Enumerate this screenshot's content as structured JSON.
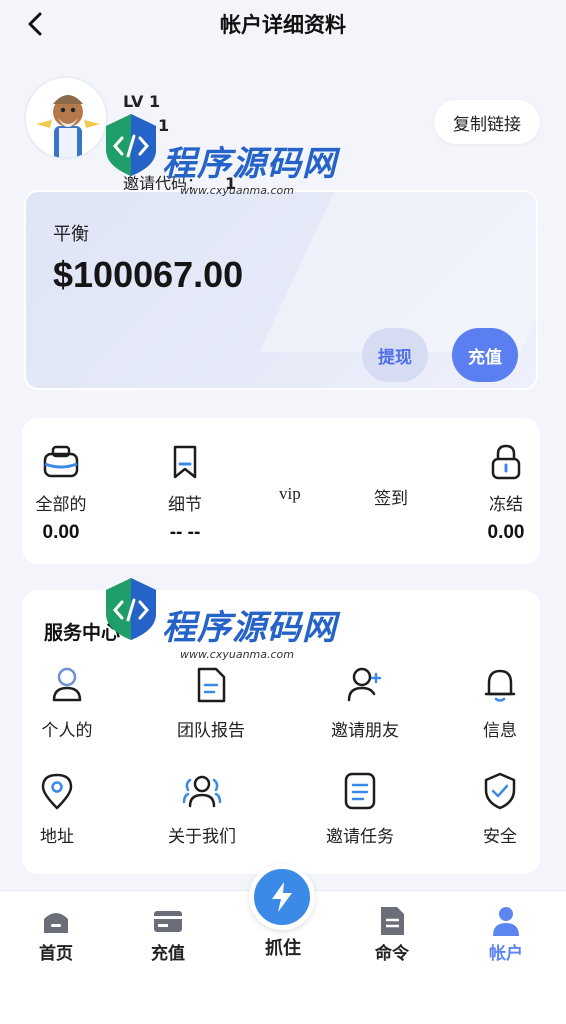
{
  "header": {
    "title": "帐户详细资料"
  },
  "profile": {
    "level": "LV 1",
    "vip": "1",
    "invite_label": "邀请代码：",
    "invite_code": "1",
    "copy_button": "复制链接"
  },
  "balance": {
    "label": "平衡",
    "value": "$100067.00",
    "withdraw_button": "提现",
    "recharge_button": "充值"
  },
  "stats": {
    "all": {
      "label": "全部的",
      "value": "0.00",
      "icon": "wallet-icon"
    },
    "detail": {
      "label": "细节",
      "value": "-- --",
      "icon": "bookmark-icon"
    },
    "vip": {
      "label": "vip"
    },
    "checkin": {
      "label": "签到"
    },
    "frozen": {
      "label": "冻结",
      "value": "0.00",
      "icon": "lock-icon"
    }
  },
  "services": {
    "title": "服务中心",
    "items": [
      {
        "label": "个人的",
        "icon": "user-icon"
      },
      {
        "label": "团队报告",
        "icon": "document-icon"
      },
      {
        "label": "邀请朋友",
        "icon": "add-user-icon"
      },
      {
        "label": "信息",
        "icon": "bell-icon"
      },
      {
        "label": "地址",
        "icon": "location-pin-icon"
      },
      {
        "label": "关于我们",
        "icon": "group-icon"
      },
      {
        "label": "邀请任务",
        "icon": "list-icon"
      },
      {
        "label": "安全",
        "icon": "shield-check-icon"
      }
    ]
  },
  "tabbar": {
    "home": "首页",
    "recharge": "充值",
    "grab": "抓住",
    "orders": "命令",
    "account": "帐户",
    "active": "account"
  },
  "watermark": {
    "text": "程序源码网",
    "url": "www.cxyuanma.com"
  },
  "colors": {
    "primary": "#5b7ef1",
    "active_tab": "#5b86f0",
    "grab_button": "#3b8ae8",
    "background": "#f3f5fa"
  }
}
